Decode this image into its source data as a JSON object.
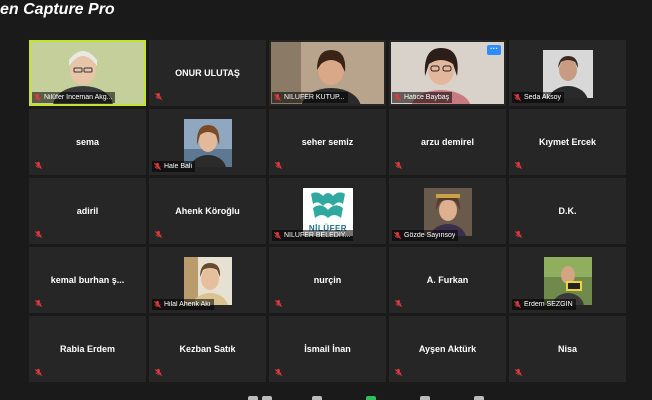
{
  "watermark": {
    "top": "soft",
    "main": "en Capture Pro"
  },
  "accent_active_border": "#c6e22b",
  "muted_icon_color": "#e0393e",
  "tiles": [
    {
      "name": "Nilüfer İnceman Akg...",
      "type": "video",
      "active": true,
      "muted": true
    },
    {
      "name": "ONUR ULUTAŞ",
      "type": "name",
      "muted": true
    },
    {
      "name": "NİLÜFER KÜTÜP...",
      "type": "video",
      "muted": true
    },
    {
      "name": "Hatice Baybaş",
      "type": "video",
      "muted": true,
      "more_button": "···"
    },
    {
      "name": "Seda Aksoy",
      "type": "photo",
      "muted": true
    },
    {
      "name": "sema",
      "type": "name",
      "muted": true
    },
    {
      "name": "Hale Bali",
      "type": "photo",
      "muted": true
    },
    {
      "name": "seher semiz",
      "type": "name",
      "muted": true
    },
    {
      "name": "arzu demirel",
      "type": "name",
      "muted": true
    },
    {
      "name": "Kıymet Ercek",
      "type": "name",
      "muted": true
    },
    {
      "name": "adiril",
      "type": "name",
      "muted": true
    },
    {
      "name": "Ahenk Köroğlu",
      "type": "name",
      "muted": true
    },
    {
      "name": "NİLÜFER BELEDİY...",
      "type": "logo",
      "muted": true,
      "logo_text": "NİLÜFER"
    },
    {
      "name": "Gözde Sayınsoy",
      "type": "photo",
      "muted": true
    },
    {
      "name": "D.K.",
      "type": "name",
      "muted": true
    },
    {
      "name": "kemal burhan ş...",
      "type": "name",
      "muted": true
    },
    {
      "name": "Hilal Ahenk Akı",
      "type": "photo",
      "muted": true
    },
    {
      "name": "nurçin",
      "type": "name",
      "muted": true
    },
    {
      "name": "A. Furkan",
      "type": "name",
      "muted": true
    },
    {
      "name": "Erdem SEZGİN",
      "type": "photo",
      "muted": true
    },
    {
      "name": "Rabia Erdem",
      "type": "name",
      "muted": true
    },
    {
      "name": "Kezban Satık",
      "type": "name",
      "muted": true
    },
    {
      "name": "İsmail İnan",
      "type": "name",
      "muted": true
    },
    {
      "name": "Ayşen Aktürk",
      "type": "name",
      "muted": true
    },
    {
      "name": "Nisa",
      "type": "name",
      "muted": true
    }
  ]
}
